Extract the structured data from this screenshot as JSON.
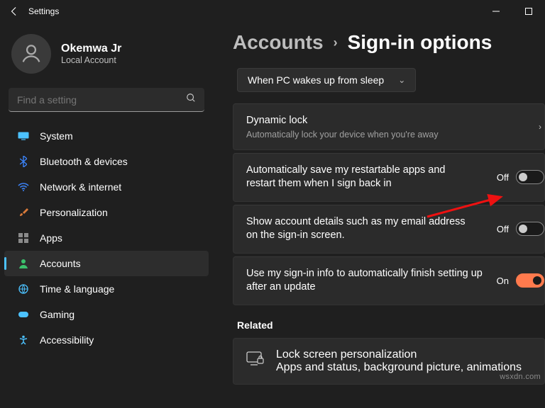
{
  "window": {
    "title": "Settings"
  },
  "user": {
    "name": "Okemwa Jr",
    "account_type": "Local Account"
  },
  "search": {
    "placeholder": "Find a setting"
  },
  "nav": {
    "items": [
      {
        "label": "System",
        "icon_color": "#4cc2ff",
        "icon": "monitor"
      },
      {
        "label": "Bluetooth & devices",
        "icon_color": "#3b82f6",
        "icon": "bluetooth"
      },
      {
        "label": "Network & internet",
        "icon_color": "#3b82f6",
        "icon": "wifi"
      },
      {
        "label": "Personalization",
        "icon_color": "#d97a3a",
        "icon": "brush"
      },
      {
        "label": "Apps",
        "icon_color": "#8a8a8a",
        "icon": "apps"
      },
      {
        "label": "Accounts",
        "icon_color": "#3bbf6b",
        "icon": "person",
        "active": true
      },
      {
        "label": "Time & language",
        "icon_color": "#4cc2ff",
        "icon": "globe"
      },
      {
        "label": "Gaming",
        "icon_color": "#4cc2ff",
        "icon": "gaming"
      },
      {
        "label": "Accessibility",
        "icon_color": "#4cc2ff",
        "icon": "accessibility"
      }
    ]
  },
  "breadcrumb": {
    "parent": "Accounts",
    "sep": "›",
    "current": "Sign-in options"
  },
  "dropdown": {
    "label": "When PC wakes up from sleep"
  },
  "cards": {
    "dynamic_lock": {
      "title": "Dynamic lock",
      "sub": "Automatically lock your device when you're away"
    },
    "restartable": {
      "title": "Automatically save my restartable apps and restart them when I sign back in",
      "state": "Off",
      "on": false
    },
    "account_details": {
      "title": "Show account details such as my email address on the sign-in screen.",
      "state": "Off",
      "on": false
    },
    "finish_setup": {
      "title": "Use my sign-in info to automatically finish setting up after an update",
      "state": "On",
      "on": true
    }
  },
  "related": {
    "heading": "Related",
    "lock_screen": {
      "title": "Lock screen personalization",
      "sub": "Apps and status, background picture, animations"
    }
  },
  "watermark": "wsxdn.com"
}
